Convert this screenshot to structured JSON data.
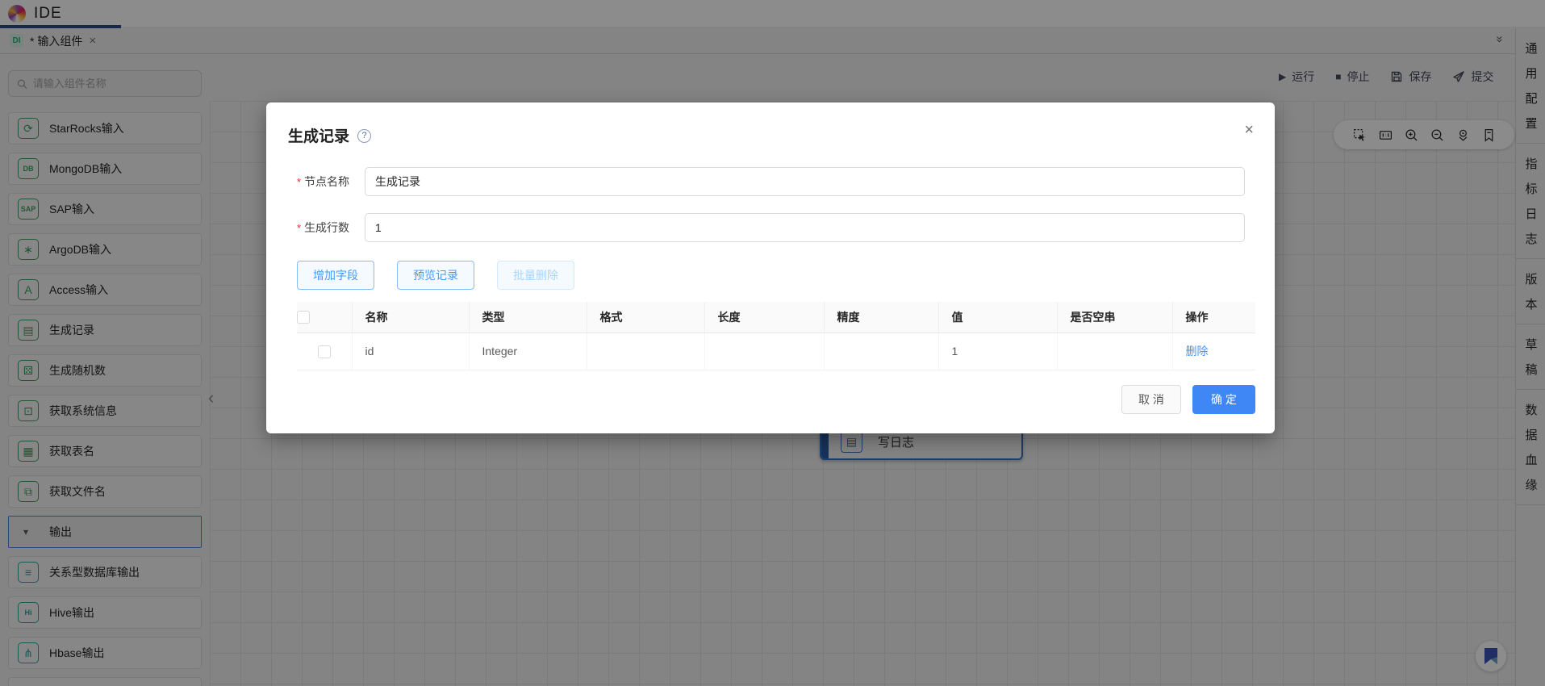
{
  "header": {
    "app_title": "IDE"
  },
  "tab_bar": {
    "tab": {
      "badge": "DI",
      "label": "* 输入组件",
      "close_glyph": "×"
    },
    "collapse_glyph": "»"
  },
  "toolbar": {
    "run_glyph": "▶",
    "run": "运行",
    "stop_glyph": "■",
    "stop": "停止",
    "save": "保存",
    "submit": "提交"
  },
  "sidebar": {
    "search_placeholder": "请输入组件名称",
    "items": [
      {
        "type": "item",
        "group": "input",
        "icon": "starrocks-icon",
        "glyph": "⟳",
        "label": "StarRocks输入"
      },
      {
        "type": "item",
        "group": "input",
        "icon": "mongodb-icon",
        "glyph": "DB",
        "label": "MongoDB输入"
      },
      {
        "type": "item",
        "group": "input",
        "icon": "sap-icon",
        "glyph": "SAP",
        "label": "SAP输入"
      },
      {
        "type": "item",
        "group": "input",
        "icon": "argodb-icon",
        "glyph": "∗",
        "label": "ArgoDB输入"
      },
      {
        "type": "item",
        "group": "input",
        "icon": "access-icon",
        "glyph": "A",
        "label": "Access输入"
      },
      {
        "type": "item",
        "group": "input",
        "icon": "generate-records-icon",
        "glyph": "▤",
        "label": "生成记录"
      },
      {
        "type": "item",
        "group": "input",
        "icon": "random-number-icon",
        "glyph": "⚄",
        "label": "生成随机数"
      },
      {
        "type": "item",
        "group": "input",
        "icon": "system-info-icon",
        "glyph": "⊡",
        "label": "获取系统信息"
      },
      {
        "type": "item",
        "group": "input",
        "icon": "table-name-icon",
        "glyph": "▦",
        "label": "获取表名"
      },
      {
        "type": "item",
        "group": "input",
        "icon": "file-name-icon",
        "glyph": "⧉",
        "label": "获取文件名"
      },
      {
        "type": "section",
        "icon": "caret-down-icon",
        "glyph": "▾",
        "label": "输出"
      },
      {
        "type": "item",
        "group": "output",
        "icon": "relational-db-output-icon",
        "glyph": "≡",
        "label": "关系型数据库输出"
      },
      {
        "type": "item",
        "group": "output",
        "icon": "hive-output-icon",
        "glyph": "Hi",
        "label": "Hive输出"
      },
      {
        "type": "item",
        "group": "output",
        "icon": "hbase-output-icon",
        "glyph": "⋔",
        "label": "Hbase输出"
      },
      {
        "type": "partial"
      }
    ]
  },
  "canvas": {
    "tools": [
      "marquee-select",
      "fit-ratio",
      "zoom-in",
      "zoom-out",
      "locate",
      "bookmark"
    ],
    "node_glyph": "▤",
    "node_label": "写日志"
  },
  "right_panel": {
    "tabs": [
      "通用配置",
      "指标日志",
      "版本",
      "草稿",
      "数据血缘"
    ]
  },
  "modal": {
    "title": "生成记录",
    "help_glyph": "?",
    "close_glyph": "×",
    "fields": [
      {
        "required": "*",
        "label": "节点名称",
        "value": "生成记录"
      },
      {
        "required": "*",
        "label": "生成行数",
        "value": "1"
      }
    ],
    "buttons": {
      "add_field": "增加字段",
      "preview": "预览记录",
      "batch_delete": "批量删除"
    },
    "table": {
      "columns": [
        "名称",
        "类型",
        "格式",
        "长度",
        "精度",
        "值",
        "是否空串",
        "操作"
      ],
      "rows": [
        {
          "cells": [
            "id",
            "Integer",
            "",
            "",
            "",
            "1",
            ""
          ],
          "action": "删除"
        }
      ]
    },
    "footer": {
      "cancel": "取 消",
      "ok": "确 定"
    }
  },
  "colors": {
    "primary": "#4096ff",
    "accent_navy": "#2b4a8b",
    "icon_green": "#3f9e5f",
    "icon_teal": "#2fa3a0",
    "danger_red": "#f5222d",
    "node_border_blue": "#3a76c4",
    "bookmark_blue": "#3d55b8"
  }
}
